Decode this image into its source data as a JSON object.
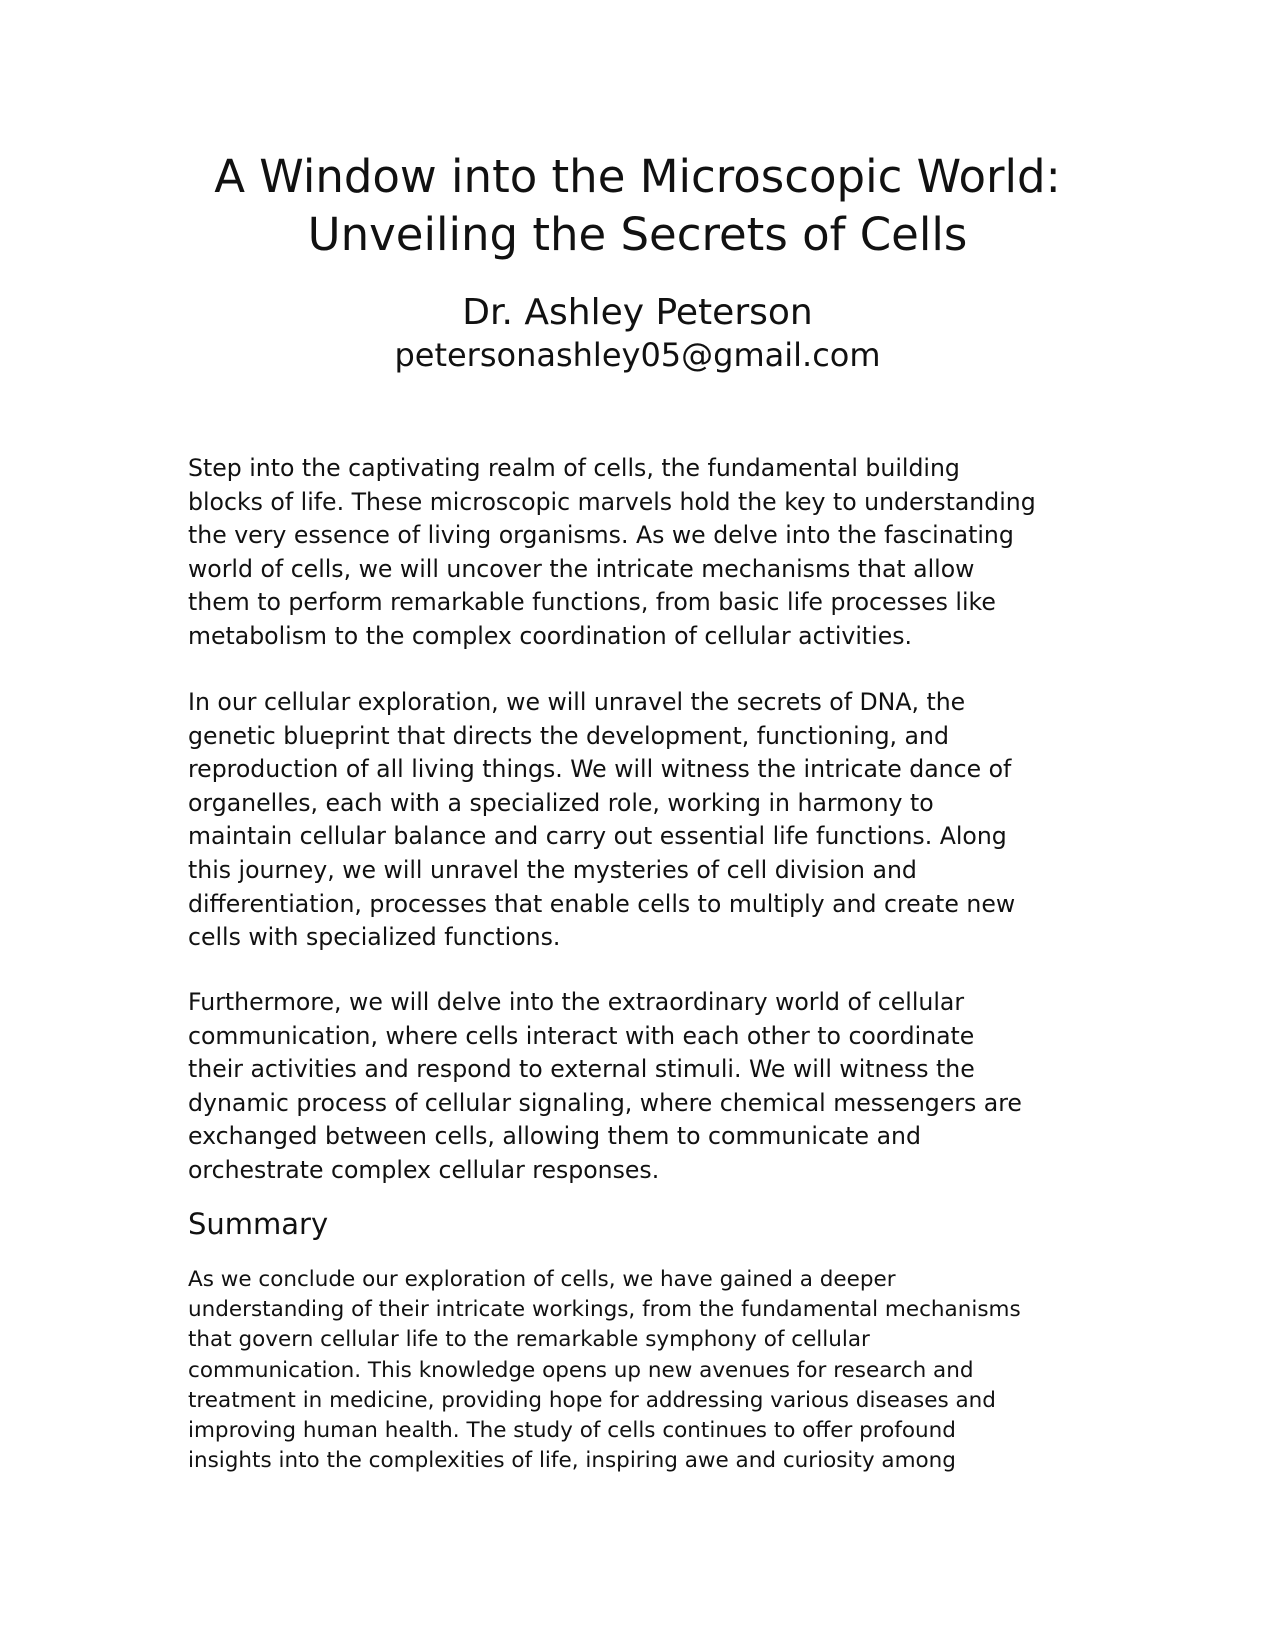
{
  "document": {
    "title_lines": [
      "A Window into the Microscopic World:",
      "Unveiling the Secrets of Cells"
    ],
    "author": "Dr. Ashley Peterson",
    "email": "petersonashley05@gmail.com",
    "paragraphs": [
      [
        "Step into the captivating realm of cells, the fundamental building",
        "blocks of life. These microscopic marvels hold the key to understanding",
        "the very essence of living organisms. As we delve into the fascinating",
        "world of cells, we will uncover the intricate mechanisms that allow",
        "them to perform remarkable functions, from basic life processes like",
        "metabolism to the complex coordination of cellular activities."
      ],
      [
        "In our cellular exploration, we will unravel the secrets of DNA, the",
        "genetic blueprint that directs the development, functioning, and",
        "reproduction of all living things. We will witness the intricate dance of",
        "organelles, each with a specialized role, working in harmony to",
        "maintain cellular balance and carry out essential life functions. Along",
        "this journey, we will unravel the mysteries of cell division and",
        "differentiation, processes that enable cells to multiply and create new",
        "cells with specialized functions."
      ],
      [
        "Furthermore, we will delve into the extraordinary world of cellular",
        "communication, where cells interact with each other to coordinate",
        "their activities and respond to external stimuli. We will witness the",
        "dynamic process of cellular signaling, where chemical messengers are",
        "exchanged between cells, allowing them to communicate and",
        "orchestrate complex cellular responses."
      ]
    ],
    "summary_heading": "Summary",
    "summary_lines": [
      "As we conclude our exploration of cells, we have gained a deeper",
      "understanding of their intricate workings, from the fundamental mechanisms",
      "that govern cellular life to the remarkable symphony of cellular",
      "communication. This knowledge opens up new avenues for research and",
      "treatment in medicine, providing hope for addressing various diseases and",
      "improving human health. The study of cells continues to offer profound",
      "insights into the complexities of life, inspiring awe and curiosity among"
    ]
  }
}
